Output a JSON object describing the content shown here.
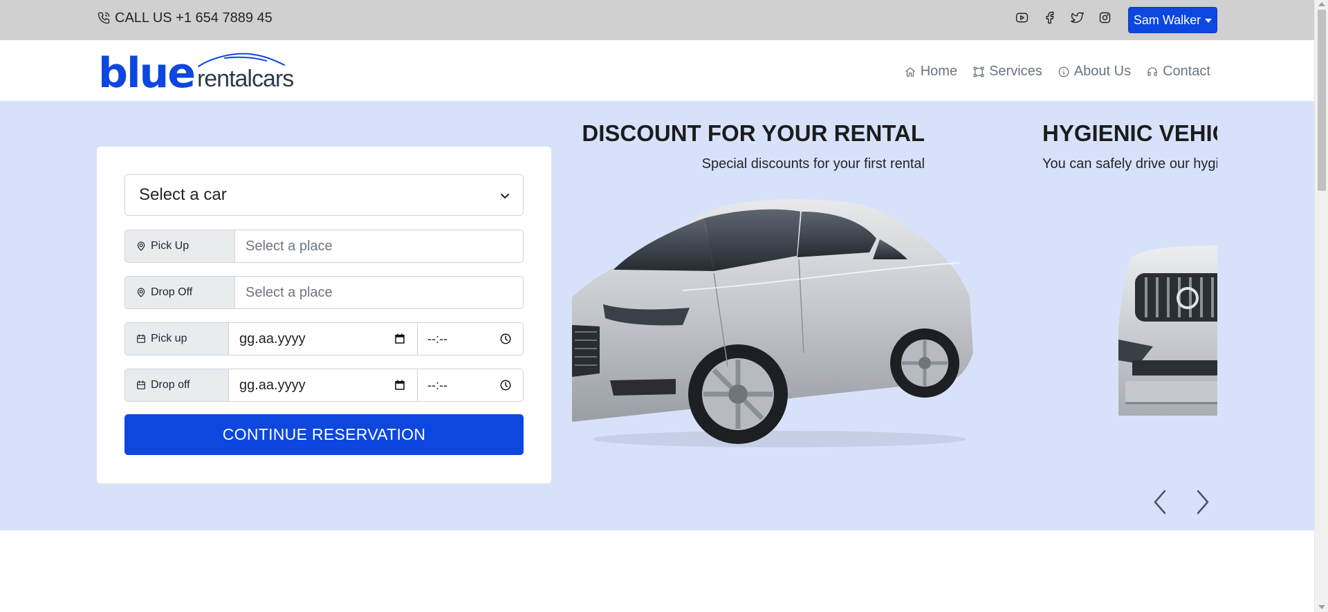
{
  "topbar": {
    "call_text": "CALL US +1 654 7889 45",
    "socials": [
      "youtube-icon",
      "facebook-icon",
      "twitter-icon",
      "instagram-icon"
    ],
    "user_button_label": "Sam Walker"
  },
  "logo": {
    "primary": "blue",
    "secondary": "rentalcars"
  },
  "nav": {
    "items": [
      {
        "label": "Home",
        "icon": "home-icon"
      },
      {
        "label": "Services",
        "icon": "services-icon"
      },
      {
        "label": "About Us",
        "icon": "info-icon"
      },
      {
        "label": "Contact",
        "icon": "headset-icon"
      }
    ]
  },
  "form": {
    "car_select": "Select a car",
    "pickup_place_label": "Pick Up",
    "pickup_place_placeholder": "Select a place",
    "dropoff_place_label": "Drop Off",
    "dropoff_place_placeholder": "Select a place",
    "pickup_date_label": "Pick up",
    "pickup_date_value": "gg.aa.yyyy",
    "pickup_time_value": "--:--",
    "dropoff_date_label": "Drop off",
    "dropoff_date_value": "gg.aa.yyyy",
    "dropoff_time_value": "--:--",
    "continue_label": "CONTINUE RESERVATION"
  },
  "carousel": {
    "slides": [
      {
        "title": "DISCOUNT FOR YOUR RENTAL",
        "subtitle": "Special discounts for your first rental"
      },
      {
        "title": "HYGIENIC VEHICLES",
        "subtitle": "You can safely drive our hygienic vehicles"
      }
    ]
  },
  "colors": {
    "accent": "#0d47e0",
    "topbar_bg": "#d0d0d0",
    "hero_bg": "#d7e2fa"
  }
}
